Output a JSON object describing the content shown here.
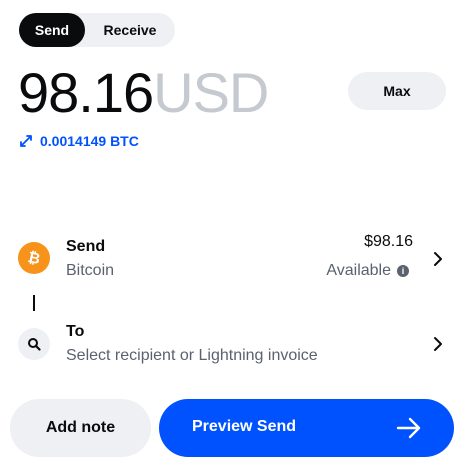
{
  "tabs": {
    "send_label": "Send",
    "receive_label": "Receive"
  },
  "amount": {
    "value": "98.16",
    "currency": "USD"
  },
  "max_label": "Max",
  "conversion": {
    "icon": "swap-arrows-icon",
    "text": "0.0014149 BTC"
  },
  "send_row": {
    "icon": "bitcoin-icon",
    "title": "Send",
    "subtitle": "Bitcoin",
    "price": "$98.16",
    "available_label": "Available",
    "info_icon": "info-icon"
  },
  "to_row": {
    "icon": "search-icon",
    "title": "To",
    "subtitle": "Select recipient or Lightning invoice"
  },
  "buttons": {
    "add_note": "Add note",
    "preview": "Preview Send"
  },
  "colors": {
    "accent": "#0052ff",
    "bitcoin": "#f7931a",
    "muted_text": "#5b616e",
    "chip_bg": "#eef0f3"
  }
}
